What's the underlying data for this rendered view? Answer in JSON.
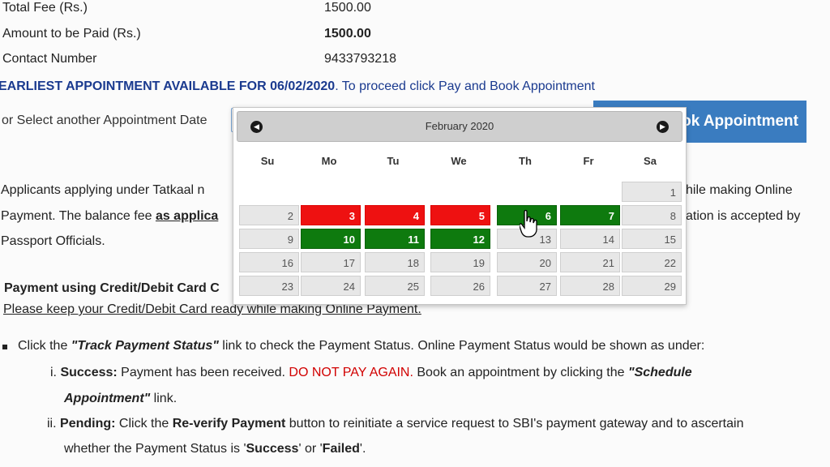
{
  "summary": {
    "total_fee_label": "Total Fee (Rs.)",
    "total_fee_value": "1500.00",
    "amount_label": "Amount to be Paid (Rs.)",
    "amount_value": "1500.00",
    "contact_label": "Contact Number",
    "contact_value": "9433793218"
  },
  "appointment": {
    "earliest_text": "EARLIEST APPOINTMENT AVAILABLE FOR 06/02/2020",
    "proceed_text": ". To proceed click Pay and Book Appointment",
    "select_label": "or Select another Appointment Date",
    "book_button": "ok Appointment"
  },
  "tatkaal": {
    "line1_left": "Applicants applying under Tatkaal n",
    "line1_right": "hile making Online",
    "line2_left_a": "Payment. The balance fee ",
    "line2_left_b": "as applica",
    "line2_right": "ation is accepted by",
    "line3": "Passport Officials."
  },
  "payment": {
    "heading": "Payment using Credit/Debit Card C",
    "note_link": "Please keep your Credit/Debit Card ready while making Online Payment."
  },
  "instructions": {
    "track_prefix": "Click the ",
    "track_link": "\"Track Payment Status\"",
    "track_suffix": " link to check the Payment Status. Online Payment Status would be shown as under:",
    "success_num": "i.",
    "success_label": "Success:",
    "success_text": " Payment has been received. ",
    "success_warning": "DO NOT PAY AGAIN.",
    "success_text2": " Book an appointment by clicking the ",
    "success_link": "\"Schedule",
    "success_link2": "Appointment\"",
    "success_end": " link.",
    "pending_num": "ii.",
    "pending_label": "Pending:",
    "pending_text": " Click the ",
    "pending_button": "Re-verify Payment",
    "pending_text2": " button to reinitiate a service request to SBI's payment gateway and to ascertain",
    "pending_line2a": "whether the Payment Status is '",
    "pending_success": "Success",
    "pending_or": "' or '",
    "pending_failed": "Failed",
    "pending_end": "'."
  },
  "calendar": {
    "month_title": "February 2020",
    "weekdays": [
      "Su",
      "Mo",
      "Tu",
      "We",
      "Th",
      "Fr",
      "Sa"
    ],
    "red_days": [
      3,
      4,
      5
    ],
    "green_days": [
      6,
      7,
      10,
      11,
      12
    ],
    "rows": [
      [
        "",
        "",
        "",
        "",
        "",
        "",
        "1"
      ],
      [
        "2",
        "3",
        "4",
        "5",
        "6",
        "7",
        "8"
      ],
      [
        "9",
        "10",
        "11",
        "12",
        "13",
        "14",
        "15"
      ],
      [
        "16",
        "17",
        "18",
        "19",
        "20",
        "21",
        "22"
      ],
      [
        "23",
        "24",
        "25",
        "26",
        "27",
        "28",
        "29"
      ]
    ],
    "colors": {
      "available": "#0e7a0e",
      "unavailable": "#ee1111",
      "disabled": "#e7e7e7"
    }
  }
}
